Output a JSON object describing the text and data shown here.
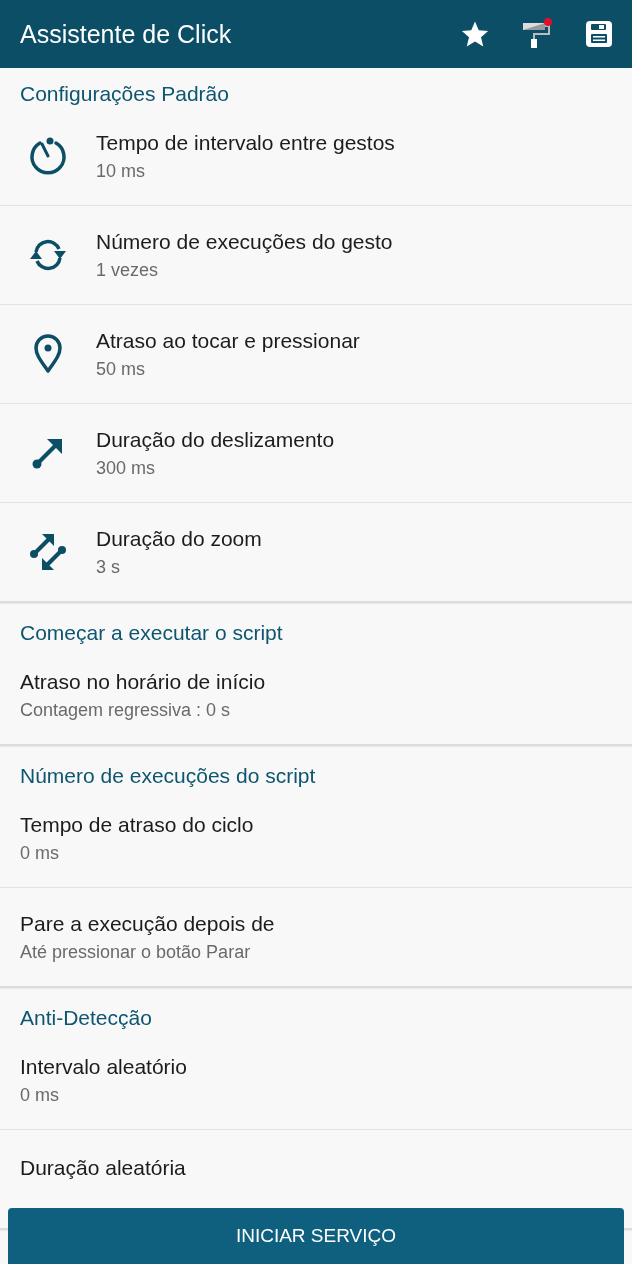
{
  "app_bar": {
    "title": "Assistente de Click",
    "paint_badge": true
  },
  "sections": [
    {
      "heading": "Configurações Padrão",
      "items": [
        {
          "kind": "timer",
          "title": "Tempo de intervalo entre gestos",
          "value": "10 ms"
        },
        {
          "kind": "repeat",
          "title": "Número de execuções do gesto",
          "value": "1 vezes"
        },
        {
          "kind": "pin",
          "title": "Atraso ao tocar e pressionar",
          "value": "50 ms"
        },
        {
          "kind": "swipe",
          "title": "Duração do deslizamento",
          "value": "300 ms"
        },
        {
          "kind": "zoom",
          "title": "Duração do zoom",
          "value": "3 s"
        }
      ]
    },
    {
      "heading": "Começar a executar o script",
      "items": [
        {
          "title": "Atraso no horário de início",
          "value": "Contagem regressiva : 0 s"
        }
      ]
    },
    {
      "heading": "Número de execuções do script",
      "items": [
        {
          "title": "Tempo de atraso do ciclo",
          "value": "0 ms"
        },
        {
          "title": "Pare a execução depois de",
          "value": "Até pressionar o botão Parar"
        }
      ]
    },
    {
      "heading": "Anti-Detecção",
      "items": [
        {
          "title": "Intervalo aleatório",
          "value": "0 ms"
        },
        {
          "title": "Duração aleatória"
        }
      ]
    }
  ],
  "start_button": "INICIAR SERVIÇO"
}
